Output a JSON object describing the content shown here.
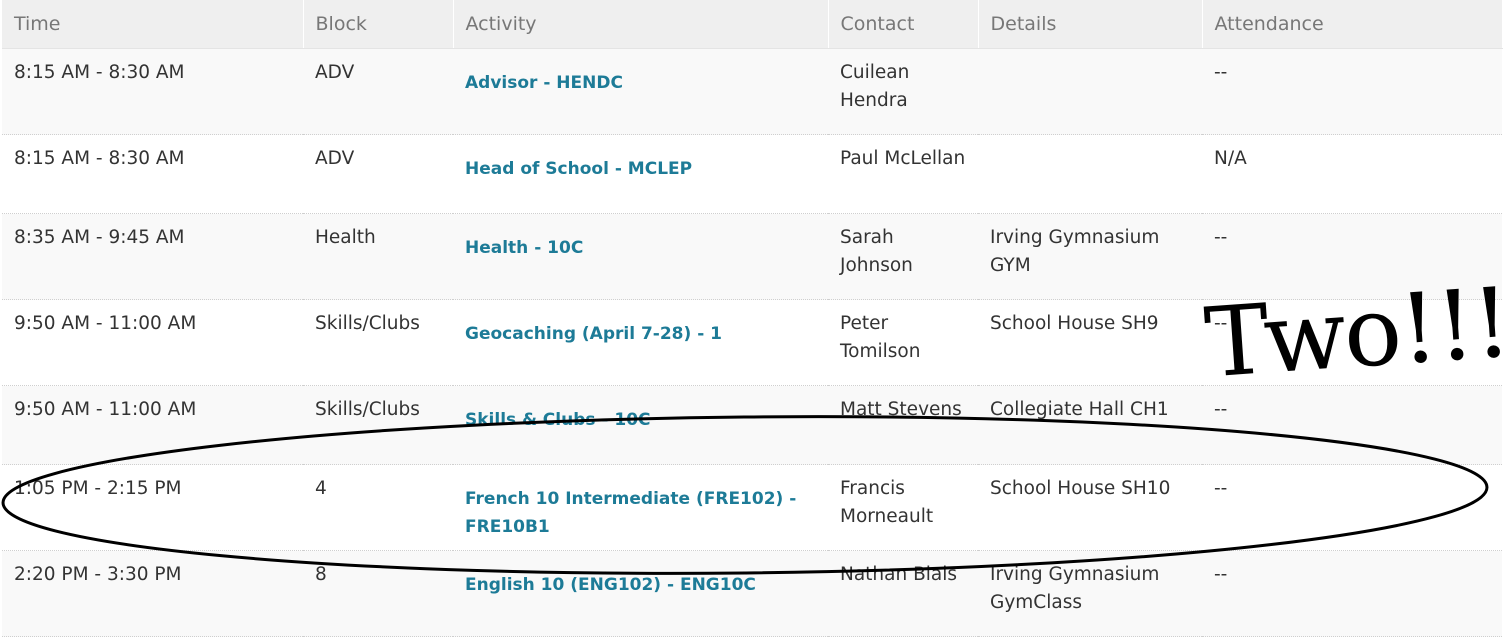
{
  "columns": {
    "time": "Time",
    "block": "Block",
    "activity": "Activity",
    "contact": "Contact",
    "details": "Details",
    "attendance": "Attendance"
  },
  "rows": [
    {
      "time": "8:15 AM - 8:30 AM",
      "block": "ADV",
      "activity": "Advisor - HENDC",
      "contact": "Cuilean Hendra",
      "details": "",
      "attendance": "--"
    },
    {
      "time": "8:15 AM - 8:30 AM",
      "block": "ADV",
      "activity": "Head of School - MCLEP",
      "contact": "Paul McLellan",
      "details": "",
      "attendance": "N/A"
    },
    {
      "time": "8:35 AM - 9:45 AM",
      "block": "Health",
      "activity": "Health - 10C",
      "contact": "Sarah Johnson",
      "details": "Irving Gymnasium GYM",
      "attendance": "--"
    },
    {
      "time": "9:50 AM - 11:00 AM",
      "block": "Skills/Clubs",
      "activity": "Geocaching (April 7-28) - 1",
      "contact": "Peter Tomilson",
      "details": "School House SH9",
      "attendance": "--"
    },
    {
      "time": "9:50 AM - 11:00 AM",
      "block": "Skills/Clubs",
      "activity": "Skills & Clubs - 10C",
      "contact": "Matt Stevens",
      "details": "Collegiate Hall CH1",
      "attendance": "--"
    },
    {
      "time": "1:05 PM - 2:15 PM",
      "block": "4",
      "activity": "French 10 Intermediate (FRE102) - FRE10B1",
      "contact": "Francis Morneault",
      "details": "School House SH10",
      "attendance": "--"
    },
    {
      "time": "2:20 PM - 3:30 PM",
      "block": "8",
      "activity": "English 10 (ENG102) - ENG10C",
      "contact": "Nathan Blais",
      "details": "Irving Gymnasium GymClass",
      "attendance": "--"
    }
  ],
  "annotation": {
    "text": "Two!!!",
    "color": "#000000"
  }
}
